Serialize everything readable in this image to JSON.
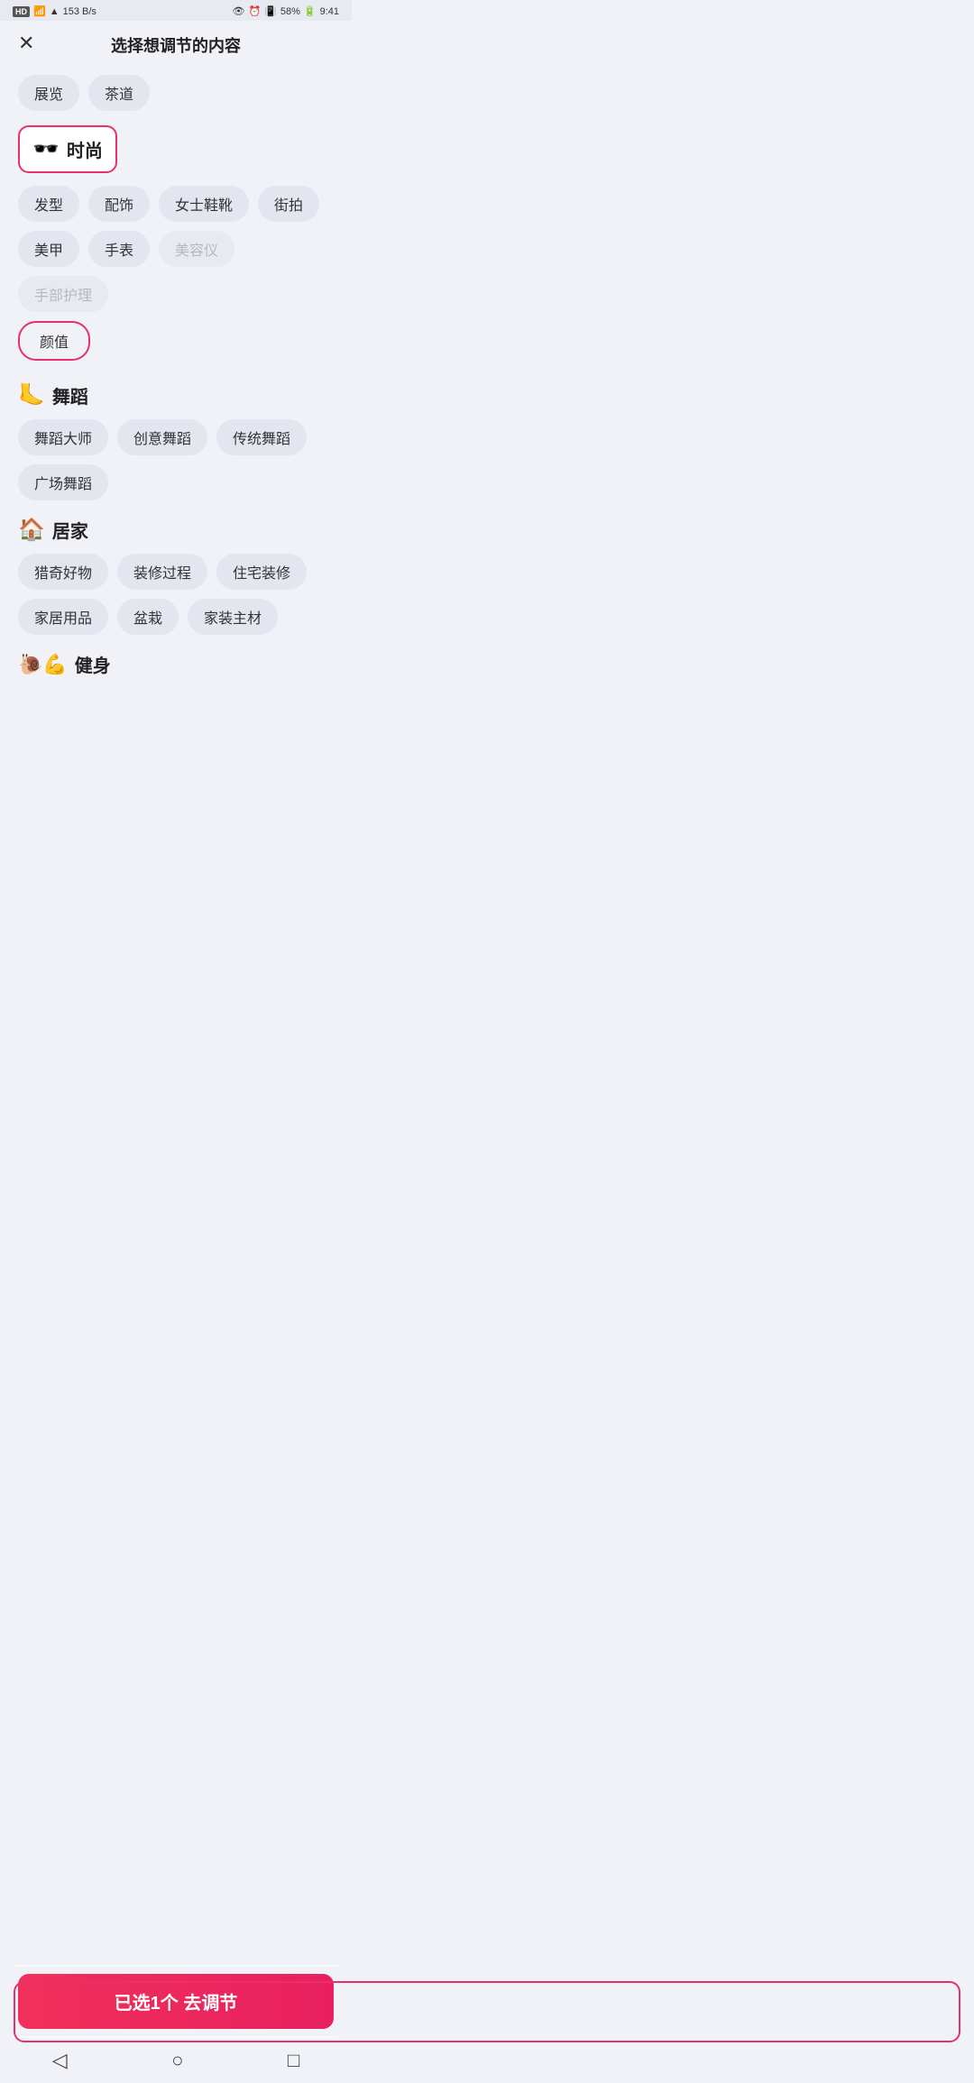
{
  "statusBar": {
    "hd": "HD",
    "signal": "4G",
    "wifi": "WiFi",
    "speed": "153 B/s",
    "eye_icon": "👁",
    "alarm": "⏰",
    "battery": "58%",
    "time": "9:41"
  },
  "header": {
    "close_label": "✕",
    "title": "选择想调节的内容"
  },
  "topTags": [
    {
      "label": "展览",
      "disabled": false
    },
    {
      "label": "茶道",
      "disabled": false
    }
  ],
  "categories": [
    {
      "icon": "🕶️",
      "name": "时尚",
      "selected": true,
      "tags": [
        {
          "label": "发型",
          "disabled": false
        },
        {
          "label": "配饰",
          "disabled": false
        },
        {
          "label": "女士鞋靴",
          "disabled": false
        },
        {
          "label": "街拍",
          "disabled": false
        }
      ],
      "tags2": [
        {
          "label": "美甲",
          "disabled": false
        },
        {
          "label": "手表",
          "disabled": false
        },
        {
          "label": "美容仪",
          "disabled": true
        },
        {
          "label": "手部护理",
          "disabled": true
        }
      ],
      "specialTag": {
        "label": "颜值",
        "selected": true
      }
    },
    {
      "icon": "🦶",
      "name": "舞蹈",
      "selected": false,
      "tags": [
        {
          "label": "舞蹈大师",
          "disabled": false
        },
        {
          "label": "创意舞蹈",
          "disabled": false
        },
        {
          "label": "传统舞蹈",
          "disabled": false
        }
      ],
      "tags2": [
        {
          "label": "广场舞蹈",
          "disabled": false
        }
      ]
    },
    {
      "icon": "🏠",
      "name": "居家",
      "selected": false,
      "tags": [
        {
          "label": "猎奇好物",
          "disabled": false
        },
        {
          "label": "装修过程",
          "disabled": false
        },
        {
          "label": "住宅装修",
          "disabled": false
        }
      ],
      "tags2": [
        {
          "label": "家居用品",
          "disabled": false
        },
        {
          "label": "盆栽",
          "disabled": false
        },
        {
          "label": "家装主材",
          "disabled": false
        }
      ]
    },
    {
      "icon": "💪",
      "name": "健身",
      "selected": false,
      "tags": []
    }
  ],
  "confirmButton": {
    "label": "已选1个 去调节"
  },
  "navigation": {
    "back": "◁",
    "home": "○",
    "recent": "□"
  }
}
